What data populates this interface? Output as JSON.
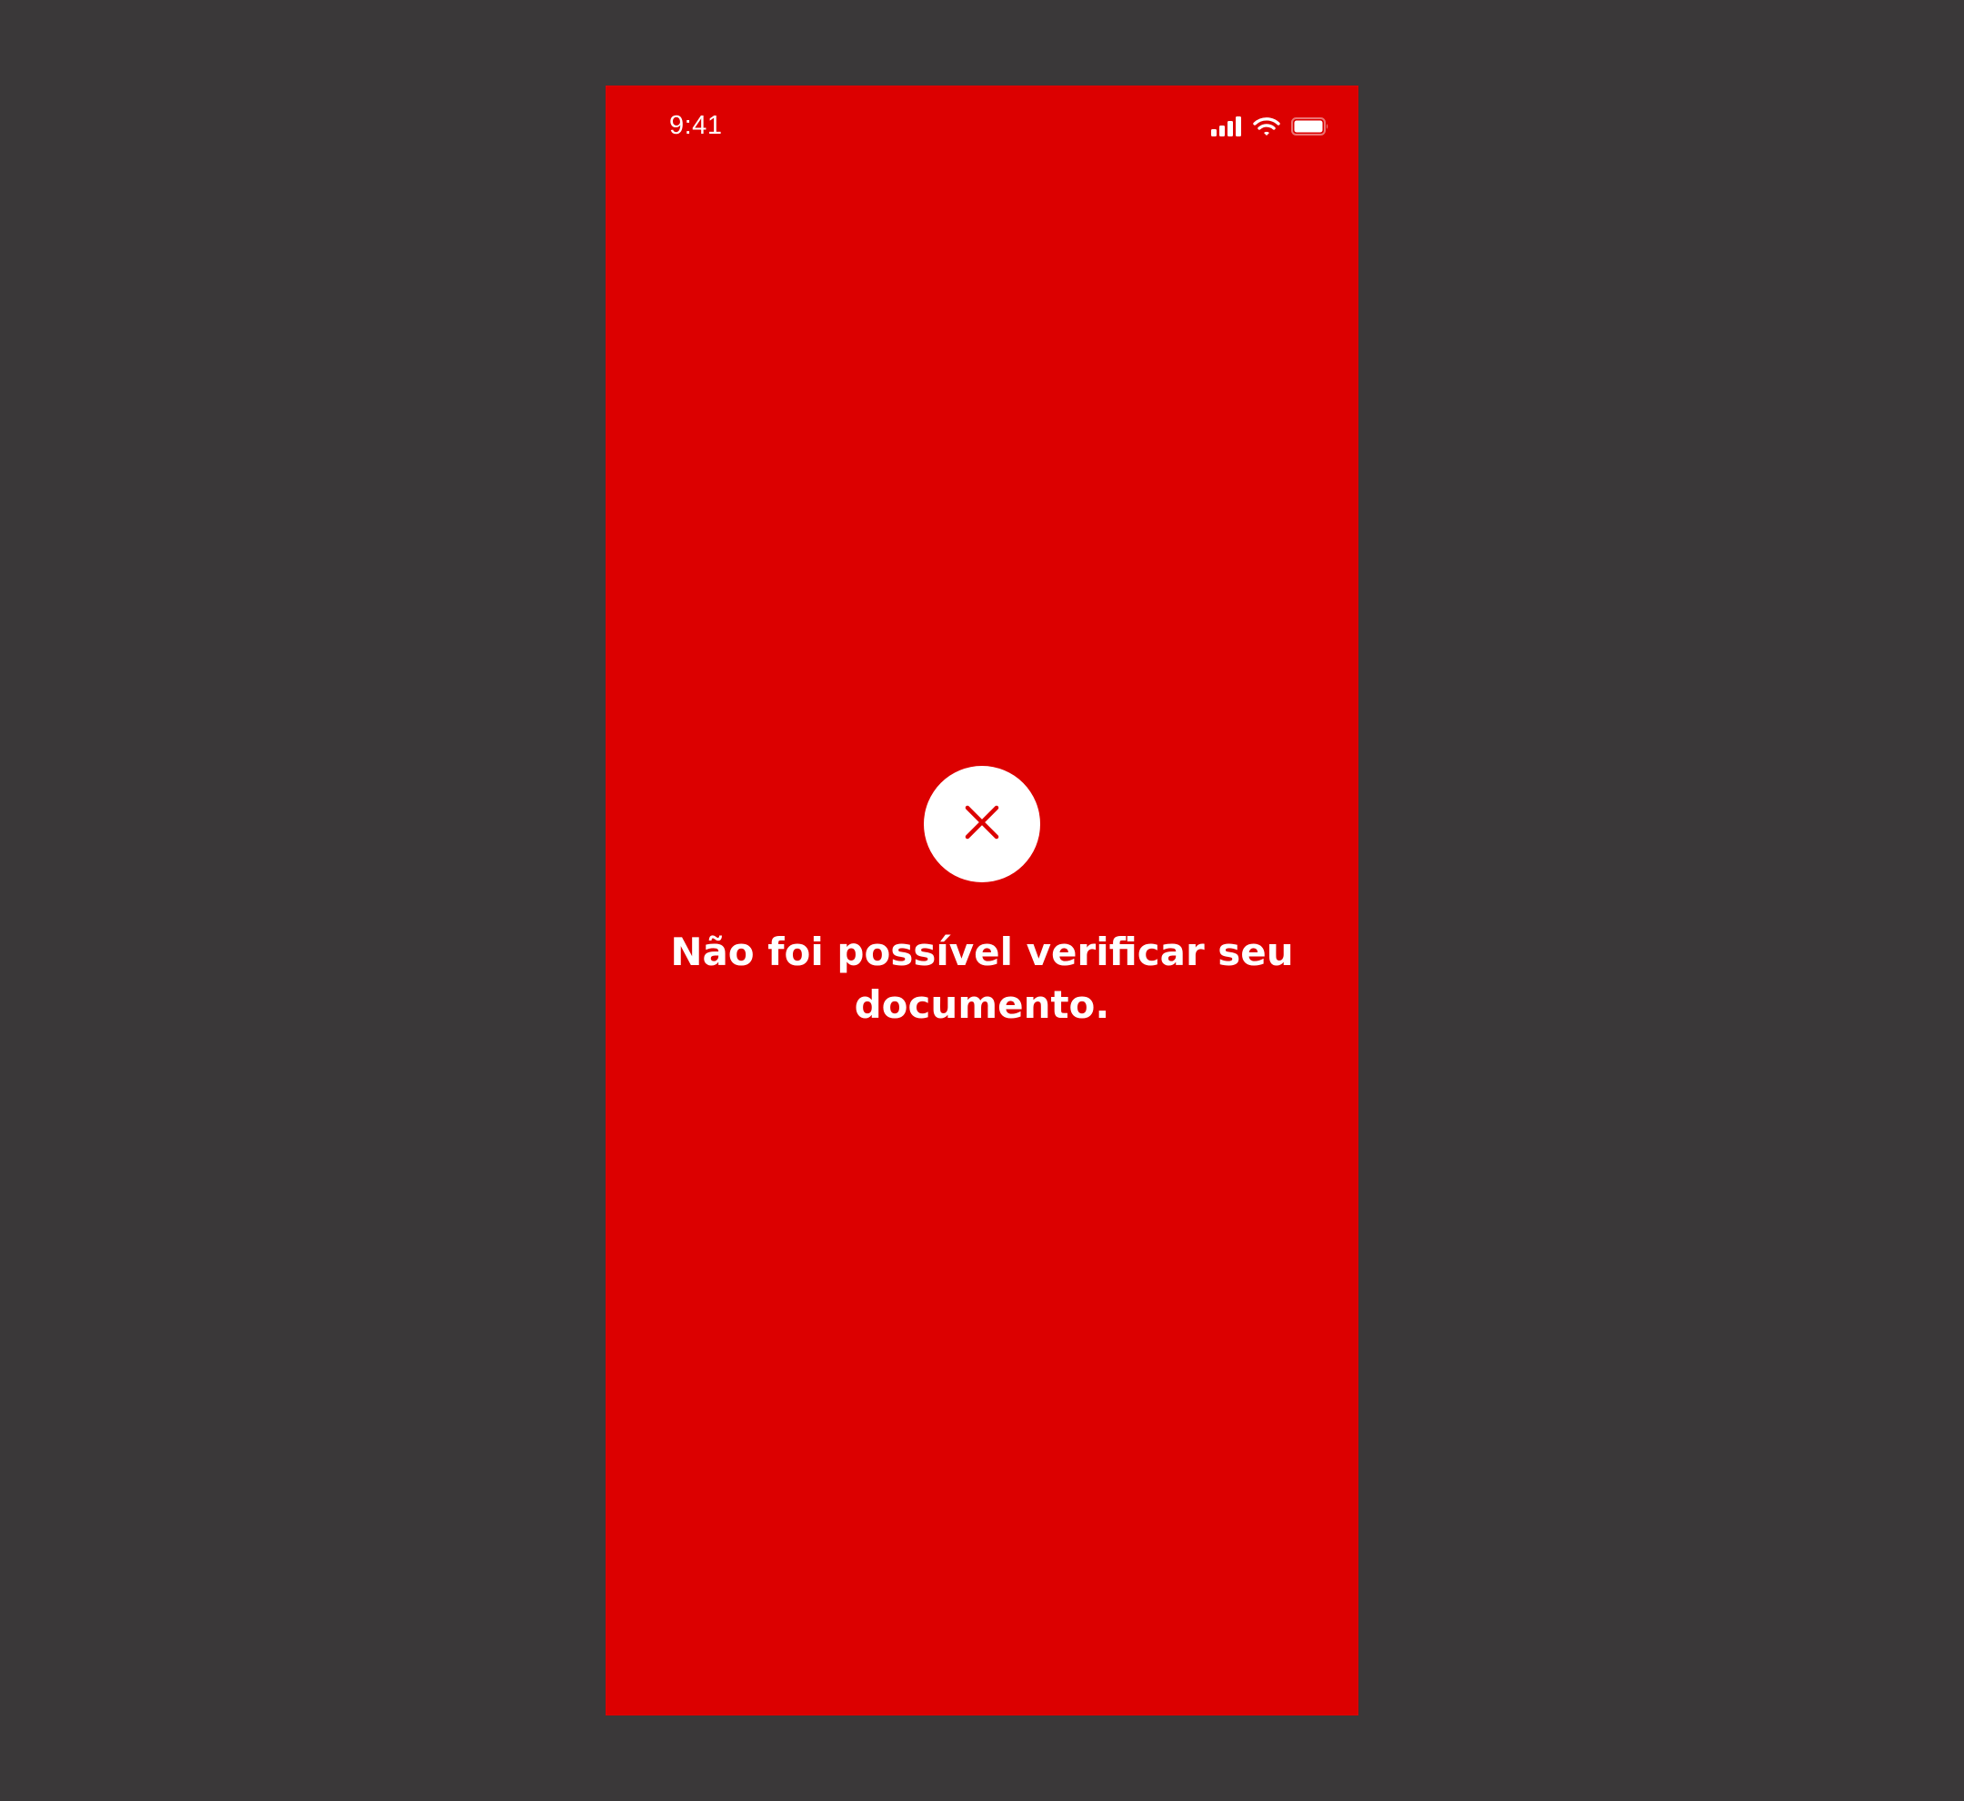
{
  "colors": {
    "backdrop": "#3a3839",
    "screen_background": "#dc0000",
    "foreground": "#ffffff",
    "icon_color": "#dc0000"
  },
  "status_bar": {
    "time": "9:41",
    "icons": [
      "cellular-signal-icon",
      "wifi-icon",
      "battery-icon"
    ]
  },
  "error": {
    "icon": "close-icon",
    "message": "Não foi possível verificar seu documento."
  }
}
